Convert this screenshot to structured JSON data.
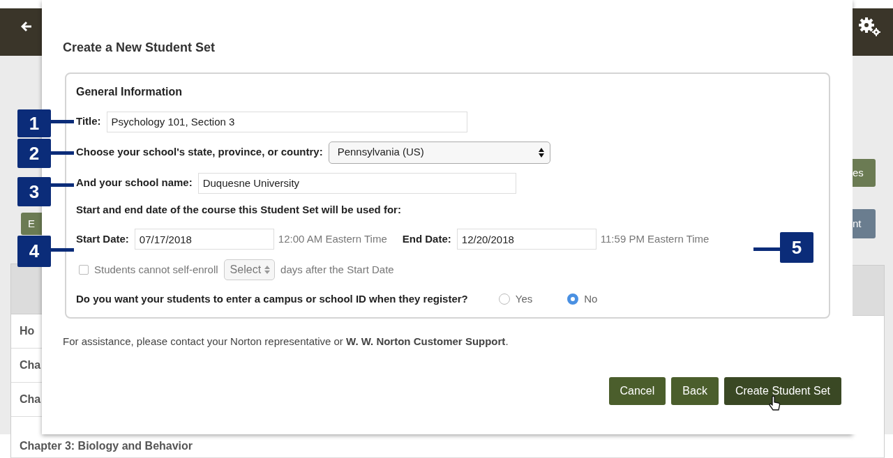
{
  "background": {
    "left_button": "E",
    "right_buttons": [
      {
        "label": "es",
        "kind": "green"
      },
      {
        "label": "nt",
        "kind": "slate"
      }
    ],
    "left_rows": [
      "Ho",
      "Cha",
      "Cha"
    ],
    "bottom_row": "Chapter 3: Biology and Behavior"
  },
  "dialog": {
    "title": "Create a New Student Set",
    "section_title": "General Information",
    "fields": [
      {
        "kind": "text",
        "label": "Title:",
        "value": "Psychology 101, Section 3"
      },
      {
        "kind": "select",
        "label": "Choose your school's state, province, or country:",
        "value": "Pennsylvania (US)"
      },
      {
        "kind": "text",
        "label": "And your school name:",
        "value": "Duquesne University"
      }
    ],
    "dates_heading": "Start and end date of the course this Student Set will be used for:",
    "dates": [
      {
        "label": "Start Date:",
        "value": "07/17/2018",
        "time": "12:00 AM Eastern Time"
      },
      {
        "label": "End Date:",
        "value": "12/20/2018",
        "time": "11:59 PM Eastern Time"
      }
    ],
    "self_enroll": {
      "checked": false,
      "disabled": true,
      "label": "Students cannot self-enroll",
      "select": "Select",
      "suffix": "days after the Start Date"
    },
    "question": {
      "text": "Do you want your students to enter a campus or school ID when they register?",
      "options": [
        {
          "label": "Yes",
          "selected": false
        },
        {
          "label": "No",
          "selected": true
        }
      ]
    },
    "help_text": "For assistance, please contact your Norton representative or **W. W. Norton Customer Support**.",
    "buttons": [
      {
        "label": "Cancel",
        "hovered": false
      },
      {
        "label": "Back",
        "hovered": false
      },
      {
        "label": "Create Student Set",
        "hovered": true
      }
    ]
  },
  "callouts": [
    "1",
    "2",
    "3",
    "4",
    "5"
  ]
}
